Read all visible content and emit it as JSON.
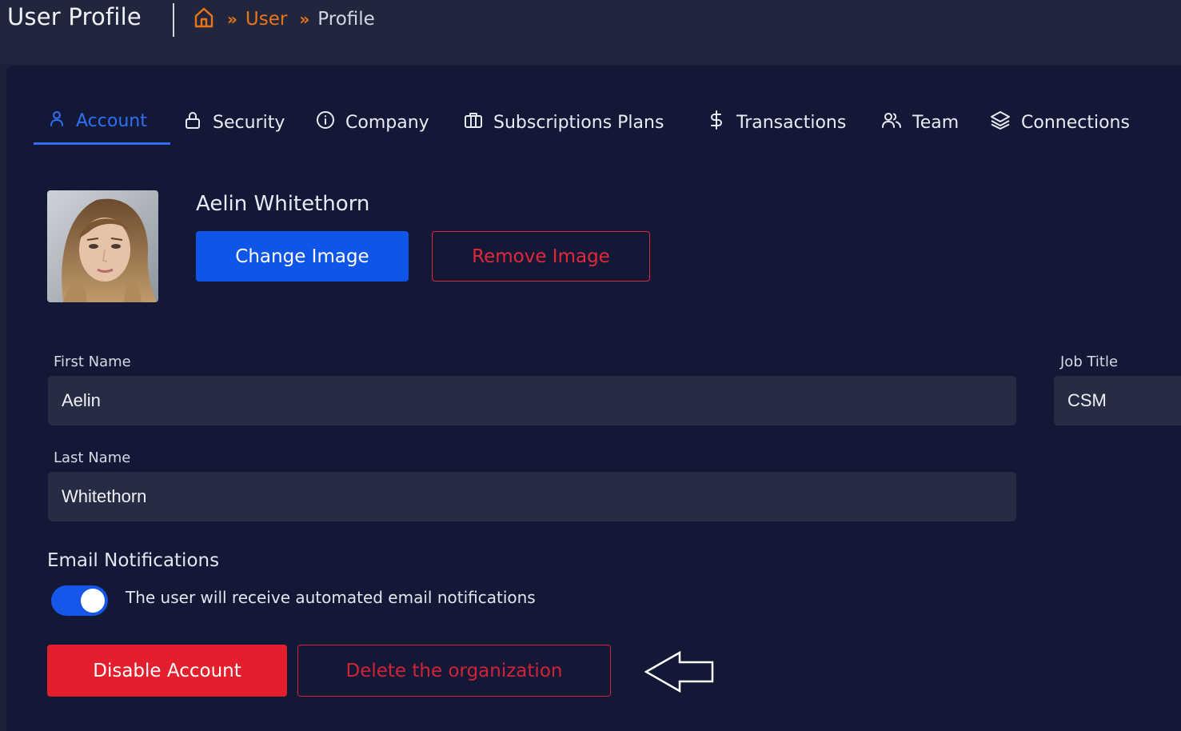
{
  "header": {
    "title": "User Profile",
    "breadcrumb": {
      "home_icon": "home-icon",
      "separator": "»",
      "user": "User",
      "profile": "Profile"
    }
  },
  "tabs": [
    {
      "label": "Account",
      "icon": "user-icon",
      "active": true
    },
    {
      "label": "Security",
      "icon": "lock-icon"
    },
    {
      "label": "Company",
      "icon": "info-circle-icon"
    },
    {
      "label": "Subscriptions Plans",
      "icon": "briefcase-icon"
    },
    {
      "label": "Transactions",
      "icon": "dollar-icon"
    },
    {
      "label": "Team",
      "icon": "users-icon"
    },
    {
      "label": "Connections",
      "icon": "layers-icon"
    }
  ],
  "profile": {
    "name": "Aelin Whitethorn",
    "change_image_label": "Change Image",
    "remove_image_label": "Remove Image"
  },
  "form": {
    "first_name_label": "First Name",
    "first_name_value": "Aelin",
    "last_name_label": "Last Name",
    "last_name_value": "Whitethorn",
    "job_title_label": "Job Title",
    "job_title_value": "CSM"
  },
  "notifications": {
    "title": "Email Notifications",
    "toggle_on": true,
    "toggle_text": "The user will receive automated email notifications"
  },
  "actions": {
    "disable_label": "Disable Account",
    "delete_label": "Delete the organization"
  },
  "colors": {
    "accent_blue": "#0f55e8",
    "danger_red": "#e41f2d",
    "breadcrumb_orange": "#e8751a",
    "card_bg": "#121836"
  }
}
